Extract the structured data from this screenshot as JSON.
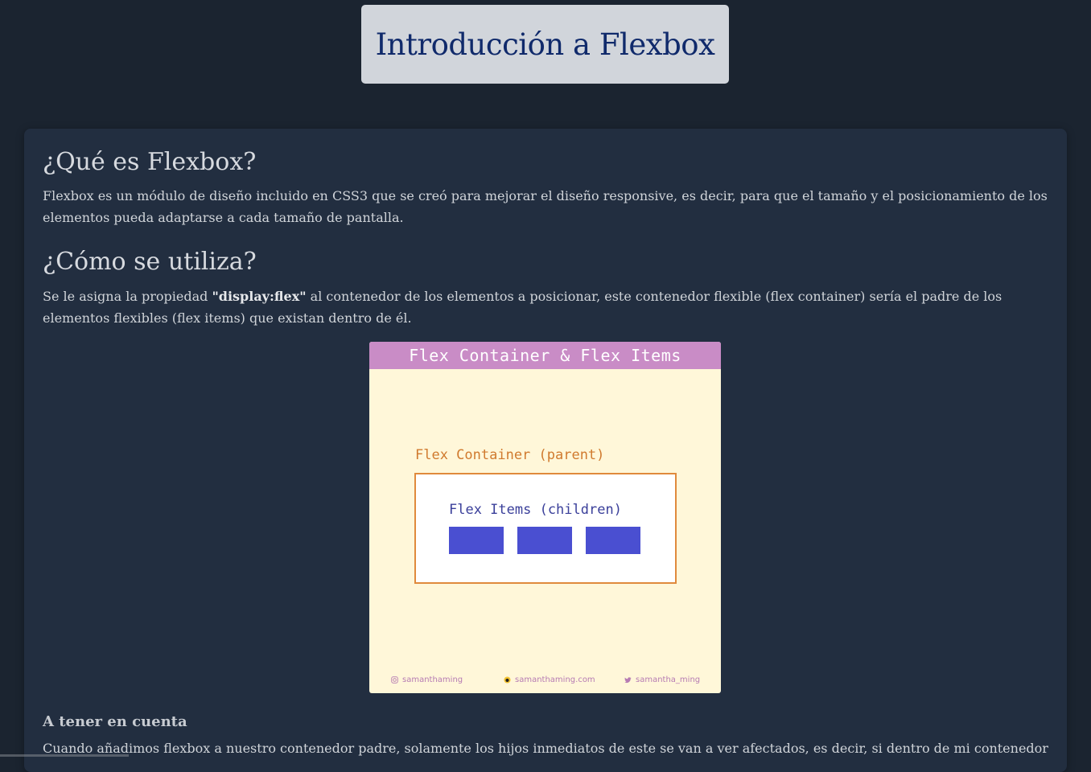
{
  "header": {
    "title": "Introducción a Flexbox"
  },
  "section_what": {
    "heading": "¿Qué es Flexbox?",
    "text": "Flexbox es un módulo de diseño incluido en CSS3 que se creó para mejorar el diseño responsive, es decir, para que el tamaño y el posicionamiento de los elementos pueda adaptarse a cada tamaño de pantalla."
  },
  "section_how": {
    "heading": "¿Cómo se utiliza?",
    "text_before": "Se le asigna la propiedad ",
    "highlight": "\"display:flex\"",
    "text_after": " al contenedor de los elementos a posicionar, este contenedor flexible (flex container) sería el padre de los elementos flexibles (flex items) que existan dentro de él."
  },
  "figure": {
    "title": "Flex Container & Flex Items",
    "container_label": "Flex Container (parent)",
    "items_label": "Flex Items (children)",
    "footer_instagram": "samanthaming",
    "footer_website": "samanthaming.com",
    "footer_twitter": "samantha_ming",
    "colors": {
      "header": "#c98cc6",
      "background": "#fff7d9",
      "container_border": "#e08a3c",
      "item": "#4a4fd1"
    }
  },
  "section_note": {
    "heading": "A tener en cuenta",
    "text": "Cuando añadimos flexbox a nuestro contenedor padre, solamente los hijos inmediatos de este se van a ver afectados, es decir, si dentro de mi contenedor"
  }
}
